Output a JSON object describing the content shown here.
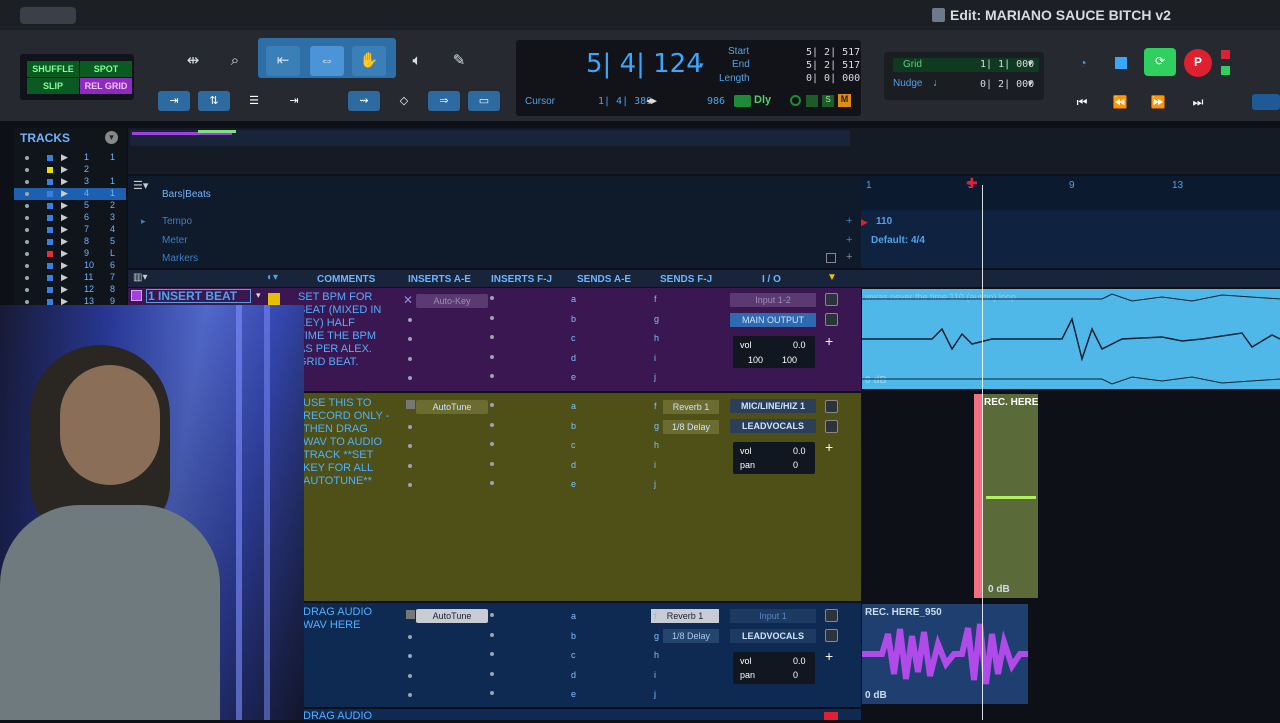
{
  "window": {
    "title": "Edit: MARIANO SAUCE BITCH v2"
  },
  "edit_modes": {
    "shuffle": "SHUFFLE",
    "spot": "SPOT",
    "slip": "SLIP",
    "grid": "REL GRID"
  },
  "counter": {
    "main": "5| 4| 124",
    "start_label": "Start",
    "start": "5| 2| 517",
    "end_label": "End",
    "end": "5| 2| 517",
    "length_label": "Length",
    "length": "0| 0| 000",
    "cursor_label": "Cursor",
    "cursor": "1| 4| 389",
    "sample": "986",
    "dly": "Dly"
  },
  "grid": {
    "grid_label": "Grid",
    "grid_value": "1| 1| 000",
    "nudge_label": "Nudge",
    "nudge_value": "0| 2| 000"
  },
  "tracks_panel": {
    "title": "TRACKS",
    "items": [
      {
        "num": "1",
        "sub": "1",
        "color": "#3a7fe0"
      },
      {
        "num": "2",
        "sub": "",
        "color": "#e6e000"
      },
      {
        "num": "3",
        "sub": "1",
        "color": "#3a7fe0"
      },
      {
        "num": "4",
        "sub": "1",
        "color": "#3a7fe0"
      },
      {
        "num": "5",
        "sub": "2",
        "color": "#3a7fe0"
      },
      {
        "num": "6",
        "sub": "3",
        "color": "#3a7fe0"
      },
      {
        "num": "7",
        "sub": "4",
        "color": "#3a7fe0"
      },
      {
        "num": "8",
        "sub": "5",
        "color": "#3a7fe0"
      },
      {
        "num": "9",
        "sub": "L",
        "color": "#e03030"
      },
      {
        "num": "10",
        "sub": "6",
        "color": "#3a7fe0"
      },
      {
        "num": "11",
        "sub": "7",
        "color": "#3a7fe0"
      },
      {
        "num": "12",
        "sub": "8",
        "color": "#3a7fe0"
      },
      {
        "num": "13",
        "sub": "9",
        "color": "#3a7fe0"
      }
    ]
  },
  "rulers": {
    "bars_beats": "Bars|Beats",
    "tempo": "Tempo",
    "meter": "Meter",
    "markers": "Markers",
    "tempo_value": "110",
    "meter_value": "Default: 4/4",
    "bar_marks": [
      "1",
      "5",
      "9",
      "13"
    ]
  },
  "columns": [
    "COMMENTS",
    "INSERTS A-E",
    "INSERTS F-J",
    "SENDS A-E",
    "SENDS F-J",
    "I / O"
  ],
  "tracks": [
    {
      "name": "1 INSERT BEAT",
      "comment": "SET BPM FOR\nBEAT (MIXED IN\nKEY) HALF\nTIME THE BPM\nAS PER ALEX.\nGRID BEAT.",
      "insert": "Auto-Key",
      "sends_ae": [
        "a",
        "b",
        "c",
        "d",
        "e"
      ],
      "sends_fj": [
        "f",
        "g",
        "h",
        "i",
        "j"
      ],
      "io_in": "Input 1-2",
      "io_out": "MAIN OUTPUT",
      "vol": "0.0",
      "pan_l": "100",
      "pan_r": "100",
      "clip_name": "wwas never the time 110 (austin) loop",
      "clip_gain": "0 dB"
    },
    {
      "comment": "USE THIS TO\nRECORD ONLY -\nTHEN DRAG\nWAV TO AUDIO\nTRACK **SET\nKEY FOR ALL\nAUTOTUNE**",
      "insert": "AutoTune",
      "sends_ae": [
        "a",
        "b",
        "c",
        "d",
        "e"
      ],
      "sends_fj": [
        "Reverb 1",
        "1/8 Delay",
        "h",
        "i",
        "j"
      ],
      "io_in": "MIC/LINE/HIZ 1",
      "io_out": "LEADVOCALS",
      "vol": "0.0",
      "pan": "0",
      "clip_name": "REC. HERE",
      "clip_gain": "0 dB"
    },
    {
      "comment": "DRAG AUDIO\nWAV HERE",
      "insert": "AutoTune",
      "sends_ae": [
        "a",
        "b",
        "c",
        "d",
        "e"
      ],
      "sends_fj": [
        "Reverb 1",
        "1/8 Delay",
        "h",
        "i",
        "j"
      ],
      "io_in": "Input 1",
      "io_out": "LEADVOCALS",
      "vol": "0.0",
      "pan": "0",
      "clip_name": "REC. HERE_950",
      "clip_gain": "0 dB"
    },
    {
      "comment": "DRAG AUDIO"
    }
  ],
  "labels": {
    "vol": "vol",
    "pan": "pan"
  }
}
